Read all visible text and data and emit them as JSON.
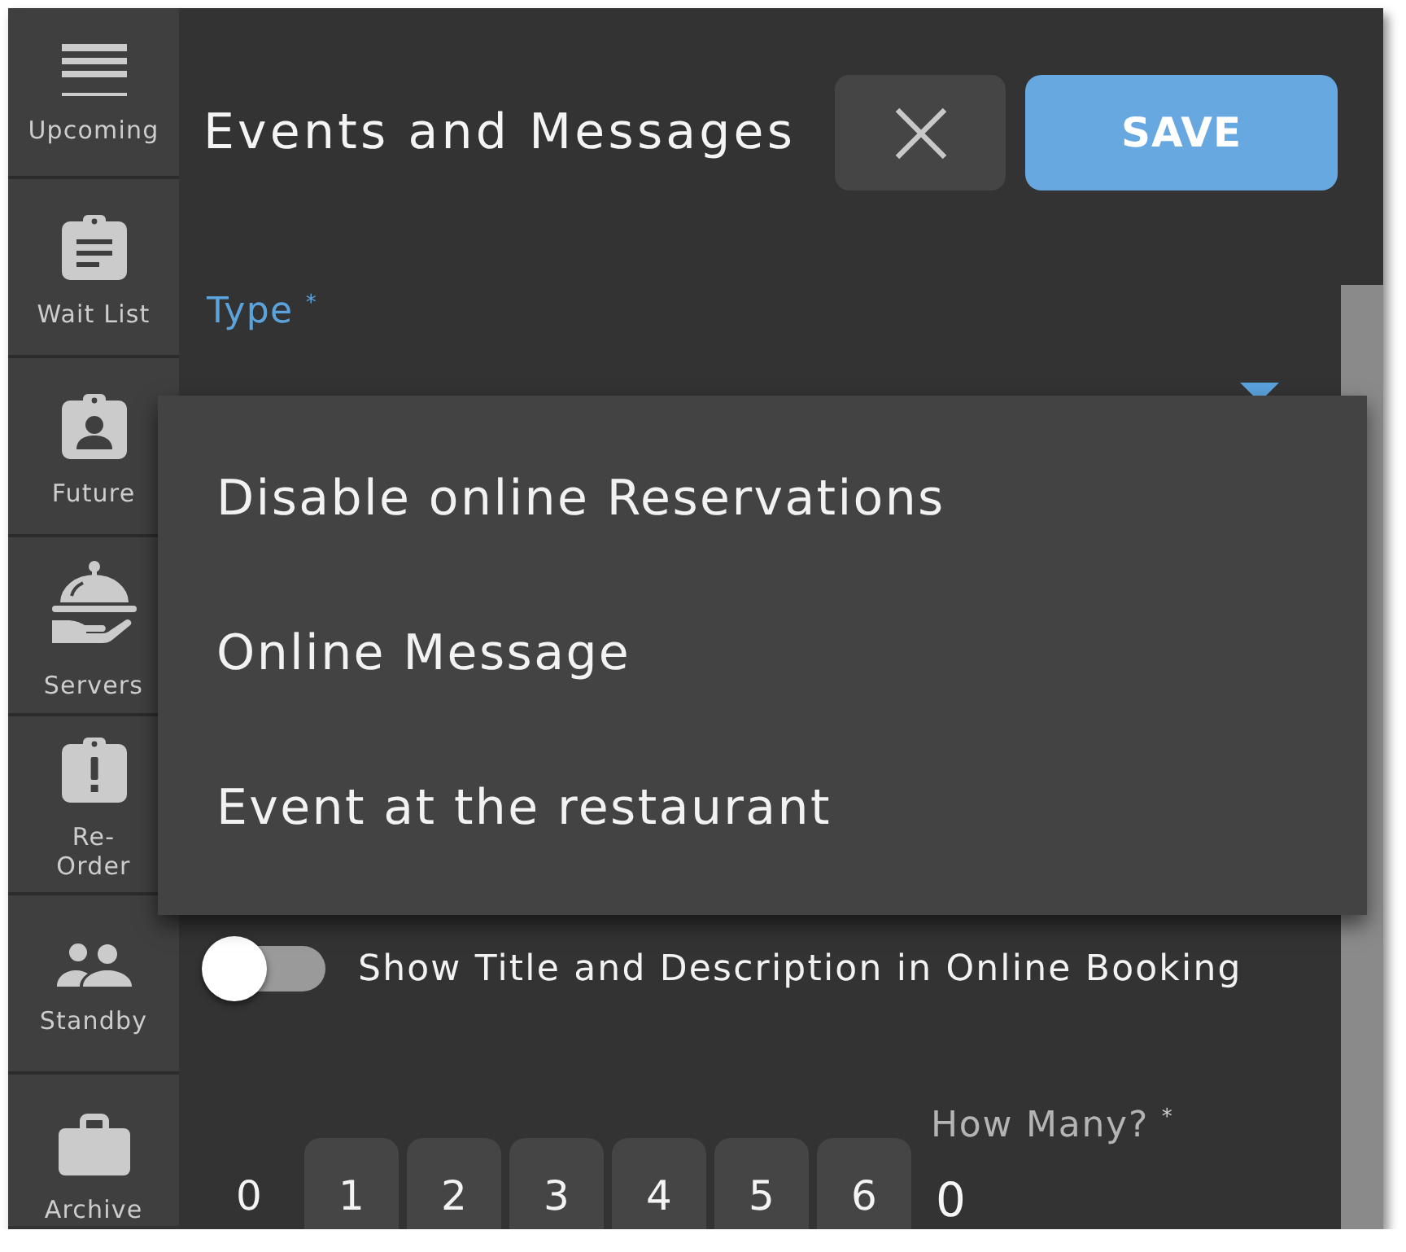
{
  "sidebar": {
    "items": [
      {
        "label": "Upcoming"
      },
      {
        "label": "Wait List"
      },
      {
        "label": "Future"
      },
      {
        "label": "Servers"
      },
      {
        "label": "Re-Order"
      },
      {
        "label": "Standby"
      },
      {
        "label": "Archive"
      }
    ]
  },
  "header": {
    "title": "Events and Messages",
    "save_button": "SAVE"
  },
  "type_field": {
    "label": "Type $^{*}$",
    "expanded": true,
    "options": [
      {
        "label": "Disable online Reservations"
      },
      {
        "label": "Online Message"
      },
      {
        "label": "Event at the restaurant"
      }
    ]
  },
  "online_toggle": {
    "label": "Show Title and Description in Online Booking",
    "on": false
  },
  "party_size": {
    "options": [
      {
        "label": "0",
        "selected": true
      },
      {
        "label": "1",
        "selected": false
      },
      {
        "label": "2",
        "selected": false
      },
      {
        "label": "3",
        "selected": false
      },
      {
        "label": "4",
        "selected": false
      },
      {
        "label": "5",
        "selected": false
      },
      {
        "label": "6",
        "selected": false
      }
    ],
    "how_many": {
      "label": "How Many? $^{*}$",
      "value": "0"
    }
  }
}
